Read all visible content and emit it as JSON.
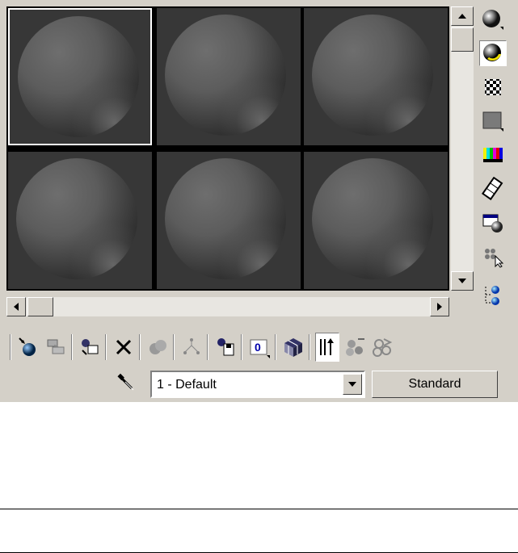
{
  "material_editor": {
    "slots": [
      {
        "label": "sample-slot-1",
        "selected": true
      },
      {
        "label": "sample-slot-2",
        "selected": false
      },
      {
        "label": "sample-slot-3",
        "selected": false
      },
      {
        "label": "sample-slot-4",
        "selected": false
      },
      {
        "label": "sample-slot-5",
        "selected": false
      },
      {
        "label": "sample-slot-6",
        "selected": false
      }
    ],
    "material_name": "1 - Default",
    "material_type_button": "Standard",
    "right_tools": [
      "sample-type-icon",
      "backlight-icon",
      "background-checker-icon",
      "sample-uv-tiling-icon",
      "video-color-check-icon",
      "make-preview-icon",
      "options-icon",
      "select-by-material-icon",
      "material-navigator-icon"
    ],
    "bottom_tools": [
      "get-material-icon",
      "put-to-scene-icon",
      "assign-to-selection-icon",
      "reset-map-icon",
      "make-unique-icon",
      "put-to-library-icon",
      "material-effects-channel-icon",
      "show-map-in-viewport-icon",
      "show-end-result-icon",
      "go-to-parent-icon",
      "go-forward-to-sibling-icon"
    ],
    "colors": {
      "panel": "#d4d0c8",
      "slot_bg": "#373737",
      "selected_border": "#ffffff"
    }
  }
}
